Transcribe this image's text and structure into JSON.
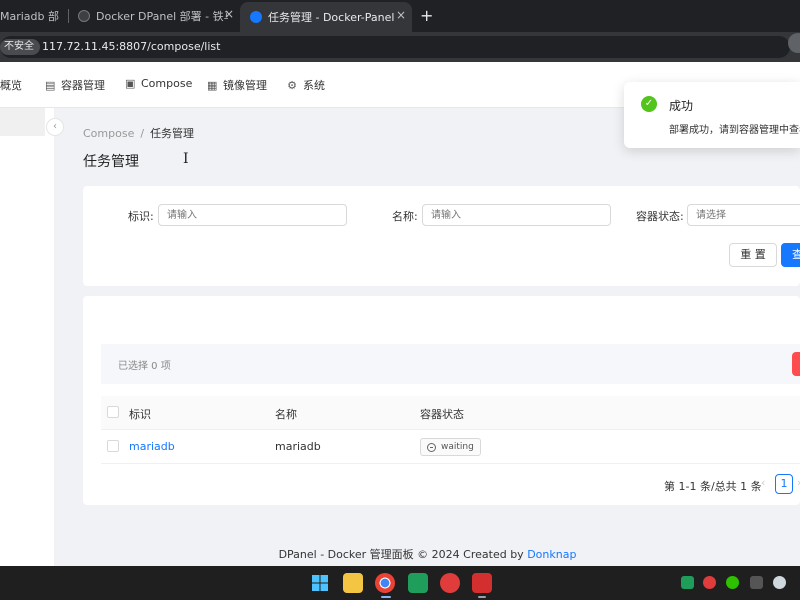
{
  "browser": {
    "tabs": [
      {
        "title": "Mariadb 部",
        "active": false
      },
      {
        "title": "Docker DPanel 部署 - 铁马冰",
        "active": false
      },
      {
        "title": "任务管理 - Docker-Panel",
        "active": true
      }
    ],
    "close_glyph": "×",
    "new_tab_glyph": "+",
    "security_label": "不安全",
    "url": "117.72.11.45:8807/compose/list"
  },
  "nav": {
    "items": [
      {
        "label": "概览",
        "icon": "dashboard-icon"
      },
      {
        "label": "容器管理",
        "icon": "container-icon"
      },
      {
        "label": "Compose",
        "icon": "compose-icon"
      },
      {
        "label": "镜像管理",
        "icon": "image-icon"
      },
      {
        "label": "系统",
        "icon": "gear-icon"
      }
    ]
  },
  "sidebar": {
    "collapse_glyph": "‹"
  },
  "breadcrumb": {
    "parent": "Compose",
    "separator": "/",
    "current": "任务管理"
  },
  "page": {
    "title": "任务管理",
    "cursor_glyph": "I"
  },
  "filters": {
    "fields": [
      {
        "label": "标识:",
        "placeholder": "请输入"
      },
      {
        "label": "名称:",
        "placeholder": "请输入"
      },
      {
        "label": "容器状态:",
        "placeholder": "请选择"
      }
    ],
    "reset_label": "重 置",
    "query_label": "查 询"
  },
  "selection": {
    "text": "已选择  0  项"
  },
  "table": {
    "columns": [
      "标识",
      "名称",
      "容器状态"
    ],
    "rows": [
      {
        "id": "mariadb",
        "name": "mariadb",
        "status": "waiting"
      }
    ]
  },
  "pagination": {
    "summary": "第 1-1 条/总共 1 条",
    "prev": "‹",
    "current_page": "1",
    "next": "›"
  },
  "footer": {
    "text": "DPanel - Docker 管理面板 © 2024 Created by ",
    "author": "Donknap"
  },
  "notification": {
    "title": "成功",
    "description": "部署成功，请到容器管理中查看",
    "check_glyph": "✓"
  },
  "colors": {
    "primary": "#1677ff",
    "success": "#52c41a",
    "danger": "#ff4d4f",
    "chrome_dark": "#202124"
  }
}
